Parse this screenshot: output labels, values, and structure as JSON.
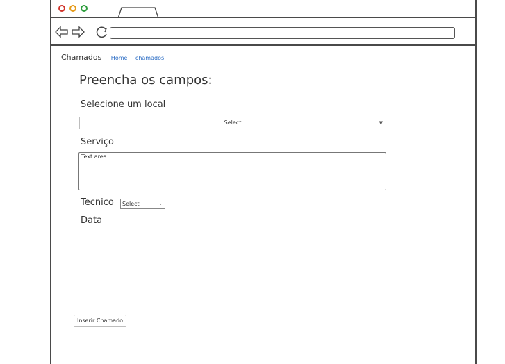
{
  "breadcrumb": {
    "current": "Chamados",
    "links": [
      "Home",
      "chamados"
    ]
  },
  "form": {
    "title": "Preencha os campos:",
    "local_label": "Selecione um local",
    "local_select_value": "Select",
    "servico_label": "Serviço",
    "servico_placeholder": "Text area",
    "tecnico_label": "Tecnico",
    "tecnico_select_value": "Select",
    "data_label": "Data",
    "submit_label": "Inserir Chamado"
  },
  "icons": {
    "back": "back-arrow-icon",
    "forward": "forward-arrow-icon",
    "reload": "reload-icon",
    "dropdown": "chevron-down-icon"
  },
  "colors": {
    "close": "#d0342c",
    "minimize": "#e59a1a",
    "maximize": "#2e9e3e",
    "link": "#2a6cc4"
  }
}
